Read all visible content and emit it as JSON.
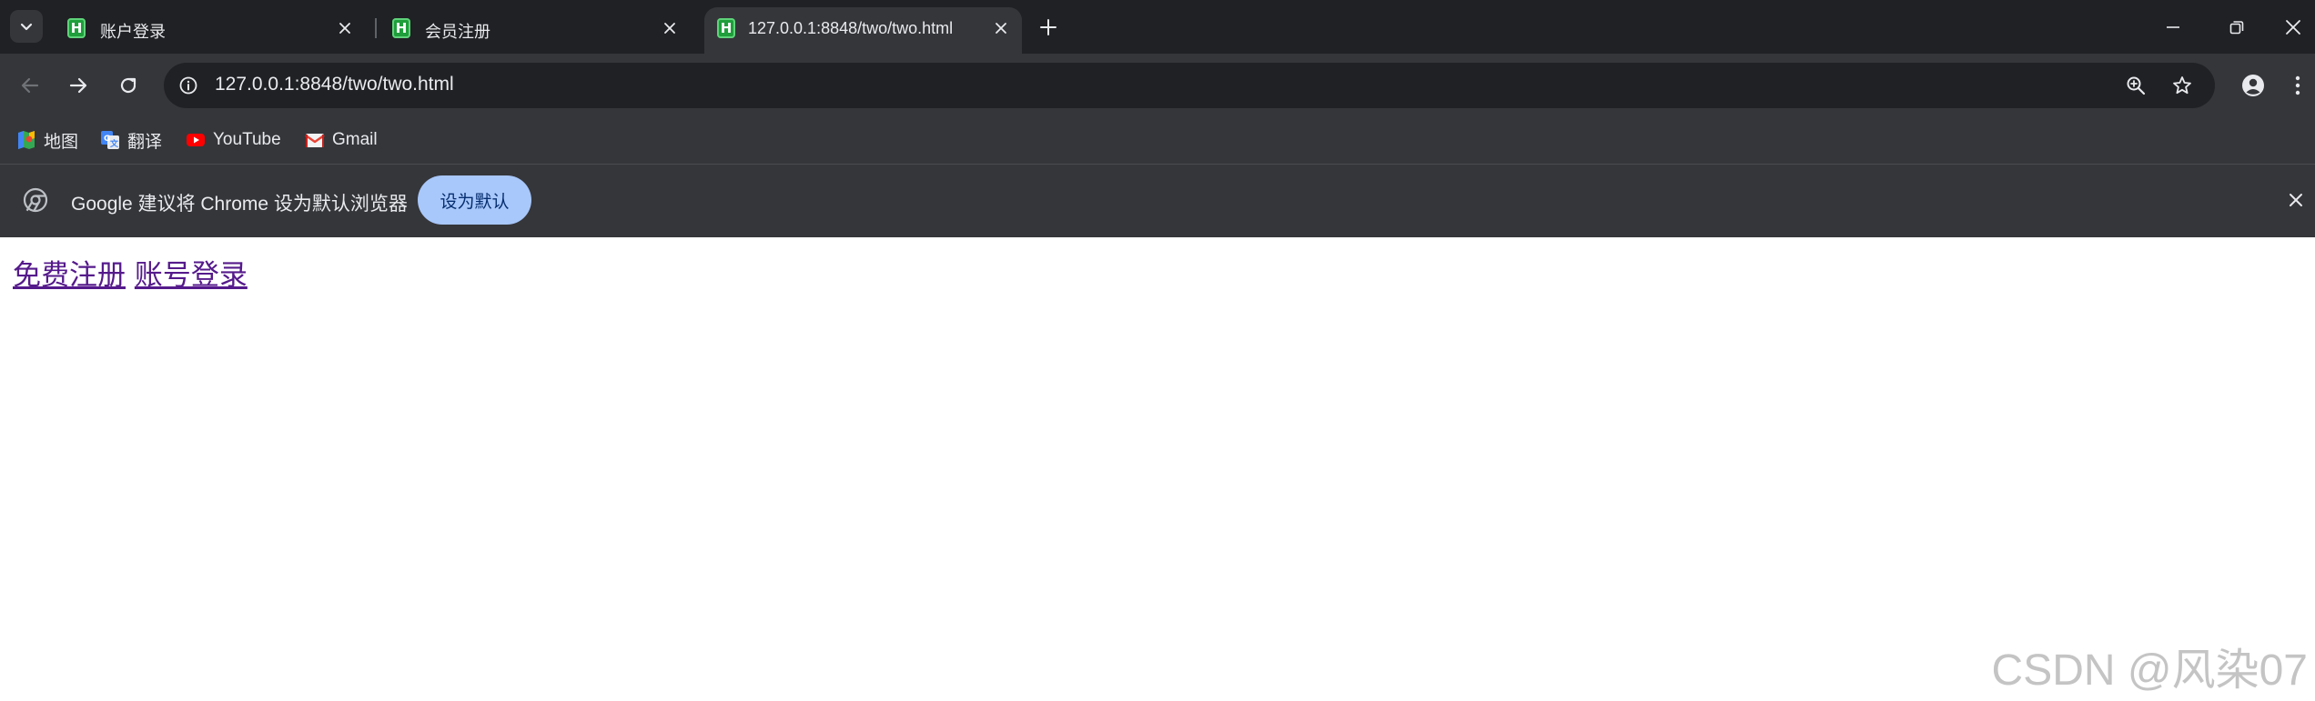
{
  "tabs": [
    {
      "title": "账户登录",
      "favicon": "H",
      "active": false
    },
    {
      "title": "会员注册",
      "favicon": "H",
      "active": false
    },
    {
      "title": "127.0.0.1:8848/two/two.html",
      "favicon": "H",
      "active": true
    }
  ],
  "address_bar": {
    "url": "127.0.0.1:8848/two/two.html"
  },
  "bookmarks": [
    {
      "label": "地图",
      "icon": "maps-icon"
    },
    {
      "label": "翻译",
      "icon": "translate-icon"
    },
    {
      "label": "YouTube",
      "icon": "youtube-icon"
    },
    {
      "label": "Gmail",
      "icon": "gmail-icon"
    }
  ],
  "infobar": {
    "message": "Google 建议将 Chrome 设为默认浏览器",
    "button_label": "设为默认"
  },
  "page": {
    "links": [
      {
        "label": "免费注册"
      },
      {
        "label": "账号登录"
      }
    ]
  },
  "watermark": "CSDN @风染07",
  "colors": {
    "tabstrip_bg": "#202124",
    "toolbar_bg": "#35363a",
    "omnibox_bg": "#202124",
    "text": "#e8eaed",
    "accent_button": "#a8c7fa",
    "visited_link": "#551a8b"
  }
}
